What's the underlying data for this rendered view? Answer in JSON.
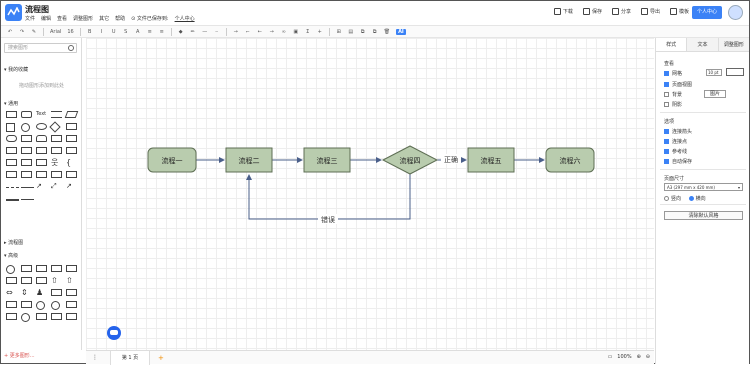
{
  "app": {
    "name": "流程图"
  },
  "menu": [
    "文件",
    "编辑",
    "查看",
    "调整图形",
    "其它",
    "帮助"
  ],
  "saved": "文件已保存到:",
  "user_link": "个人中心",
  "actions": [
    "下载",
    "保存",
    "分享",
    "导出",
    "模板"
  ],
  "user_center": "个人中心",
  "toolbar": {
    "font": "Arial",
    "size": "16",
    "ai": "AI"
  },
  "sidebar": {
    "search_placeholder": "搜索图形",
    "favorites": "我的收藏",
    "favorites_empty": "拖动图形添加到此处",
    "general": "通用",
    "flowchart": "流程图",
    "advanced": "高级",
    "more": "+ 更多图形..."
  },
  "diagram": {
    "nodes": [
      {
        "label": "流程一",
        "shape": "rect"
      },
      {
        "label": "流程二",
        "shape": "rect"
      },
      {
        "label": "流程三",
        "shape": "rect"
      },
      {
        "label": "流程四",
        "shape": "diamond"
      },
      {
        "label": "流程五",
        "shape": "rect"
      },
      {
        "label": "流程六",
        "shape": "rect"
      }
    ],
    "edge_labels": {
      "yes": "正确",
      "no": "错误"
    },
    "node_fill": "#b9ccae",
    "node_stroke": "#5e6e54",
    "edge_color": "#4a5f8a"
  },
  "rpanel": {
    "tabs": [
      "样式",
      "文本",
      "调整图形"
    ],
    "view": "查看",
    "grid": "网格",
    "grid_size": "10 pt",
    "page_view": "页面视图",
    "background": "背景",
    "image_btn": "图片",
    "shadow": "阴影",
    "options": "选项",
    "connection_arrows": "连接箭头",
    "connection_points": "连接点",
    "guides": "参考线",
    "autosave": "自动保存",
    "paper_size": "页面尺寸",
    "paper_value": "A3 (297 mm x 420 mm)",
    "portrait": "竖向",
    "landscape": "横向",
    "reset_btn": "清除默认风格"
  },
  "status": {
    "page": "第 1 页",
    "zoom": "100%"
  }
}
